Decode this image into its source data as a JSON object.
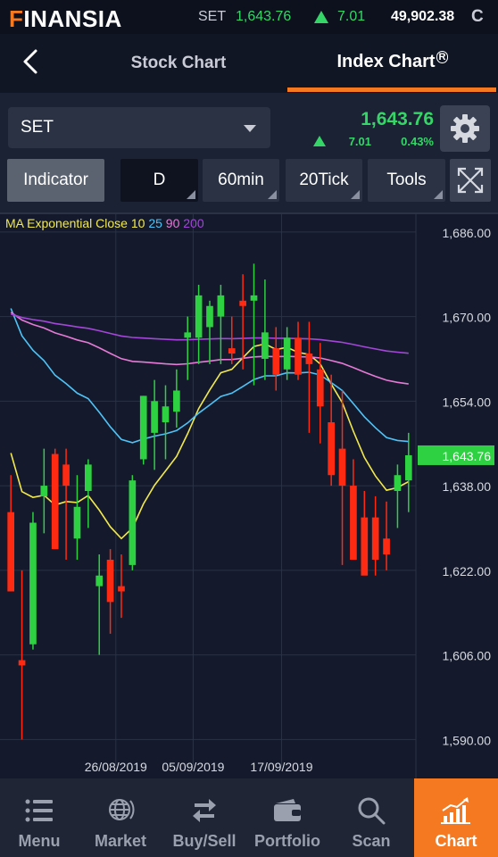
{
  "topbar": {
    "brand_mark": "F",
    "brand_rest": "INANSIA",
    "index_name": "SET",
    "index_value": "1,643.76",
    "index_change": "7.01",
    "volume": "49,902.38",
    "market_status": "C"
  },
  "header": {
    "back_icon": "chevron-left-icon",
    "tabs": [
      {
        "label": "Stock Chart",
        "active": false
      },
      {
        "label": "Index Chart",
        "active": true
      }
    ],
    "registered_mark": "R"
  },
  "symbol_bar": {
    "symbol": "SET",
    "price": "1,643.76",
    "change": "7.01",
    "percent": "0.43%",
    "direction": "up"
  },
  "toolbar": {
    "indicator": "Indicator",
    "daily": "D",
    "min60": "60min",
    "tick20": "20Tick",
    "tools": "Tools",
    "expand_icon": "expand-icon",
    "settings_icon": "gear-icon"
  },
  "chart_data": {
    "type": "candlestick",
    "indicator_label": "MA Exponential Close",
    "ma_periods": [
      "10",
      "25",
      "90",
      "200"
    ],
    "ma_colors": {
      "10": "#f2e94e",
      "25": "#4fc3f7",
      "90": "#e57bd6",
      "200": "#a347d9"
    },
    "y_ticks": [
      "1,686.00",
      "1,670.00",
      "1,654.00",
      "1,638.00",
      "1,622.00",
      "1,606.00",
      "1,590.00"
    ],
    "y_tick_values": [
      1686,
      1670,
      1654,
      1638,
      1622,
      1606,
      1590
    ],
    "ylim": [
      1586,
      1688
    ],
    "x_ticks": [
      "26/08/2019",
      "05/09/2019",
      "17/09/2019"
    ],
    "x_tick_after_index": [
      9,
      16,
      24
    ],
    "last_price_label": "1,643.76",
    "candles": [
      {
        "o": 1633,
        "h": 1640,
        "l": 1620,
        "c": 1618
      },
      {
        "o": 1605,
        "h": 1622,
        "l": 1590,
        "c": 1604
      },
      {
        "o": 1608,
        "h": 1633,
        "l": 1607,
        "c": 1631
      },
      {
        "o": 1636,
        "h": 1645,
        "l": 1629,
        "c": 1638
      },
      {
        "o": 1644,
        "h": 1645,
        "l": 1626,
        "c": 1626
      },
      {
        "o": 1642,
        "h": 1645,
        "l": 1624,
        "c": 1638
      },
      {
        "o": 1628,
        "h": 1640,
        "l": 1624,
        "c": 1634
      },
      {
        "o": 1637,
        "h": 1643,
        "l": 1630,
        "c": 1642
      },
      {
        "o": 1619,
        "h": 1625,
        "l": 1606,
        "c": 1621
      },
      {
        "o": 1624,
        "h": 1626,
        "l": 1610,
        "c": 1616
      },
      {
        "o": 1619,
        "h": 1625,
        "l": 1613,
        "c": 1618
      },
      {
        "o": 1623,
        "h": 1640,
        "l": 1622,
        "c": 1639
      },
      {
        "o": 1643,
        "h": 1655,
        "l": 1642,
        "c": 1655
      },
      {
        "o": 1648,
        "h": 1658,
        "l": 1641,
        "c": 1654
      },
      {
        "o": 1650,
        "h": 1657,
        "l": 1643,
        "c": 1653
      },
      {
        "o": 1652,
        "h": 1660,
        "l": 1649,
        "c": 1656
      },
      {
        "o": 1666,
        "h": 1670,
        "l": 1658,
        "c": 1667
      },
      {
        "o": 1666,
        "h": 1676,
        "l": 1661,
        "c": 1674
      },
      {
        "o": 1668,
        "h": 1673,
        "l": 1661,
        "c": 1672
      },
      {
        "o": 1670,
        "h": 1676,
        "l": 1661,
        "c": 1674
      },
      {
        "o": 1664,
        "h": 1670,
        "l": 1661,
        "c": 1663
      },
      {
        "o": 1673,
        "h": 1678,
        "l": 1660,
        "c": 1672
      },
      {
        "o": 1673,
        "h": 1680,
        "l": 1657,
        "c": 1674
      },
      {
        "o": 1662,
        "h": 1677,
        "l": 1658,
        "c": 1667
      },
      {
        "o": 1664,
        "h": 1668,
        "l": 1656,
        "c": 1659
      },
      {
        "o": 1660,
        "h": 1668,
        "l": 1658,
        "c": 1666
      },
      {
        "o": 1666,
        "h": 1669,
        "l": 1658,
        "c": 1659
      },
      {
        "o": 1663,
        "h": 1669,
        "l": 1648,
        "c": 1661
      },
      {
        "o": 1660,
        "h": 1665,
        "l": 1646,
        "c": 1653
      },
      {
        "o": 1650,
        "h": 1659,
        "l": 1638,
        "c": 1640
      },
      {
        "o": 1645,
        "h": 1656,
        "l": 1623,
        "c": 1638
      },
      {
        "o": 1638,
        "h": 1643,
        "l": 1625,
        "c": 1624
      },
      {
        "o": 1632,
        "h": 1637,
        "l": 1622,
        "c": 1621
      },
      {
        "o": 1632,
        "h": 1636,
        "l": 1621,
        "c": 1624
      },
      {
        "o": 1628,
        "h": 1635,
        "l": 1622,
        "c": 1625
      },
      {
        "o": 1637,
        "h": 1642,
        "l": 1630,
        "c": 1640
      },
      {
        "o": 1639,
        "h": 1648,
        "l": 1633,
        "c": 1643.76
      }
    ]
  },
  "bottom_nav": [
    {
      "label": "Menu",
      "icon": "menu-icon",
      "active": false
    },
    {
      "label": "Market",
      "icon": "globe-icon",
      "active": false
    },
    {
      "label": "Buy/Sell",
      "icon": "swap-icon",
      "active": false
    },
    {
      "label": "Portfolio",
      "icon": "wallet-icon",
      "active": false
    },
    {
      "label": "Scan",
      "icon": "magnifier-icon",
      "active": false
    },
    {
      "label": "Chart",
      "icon": "chart-icon",
      "active": true
    }
  ]
}
